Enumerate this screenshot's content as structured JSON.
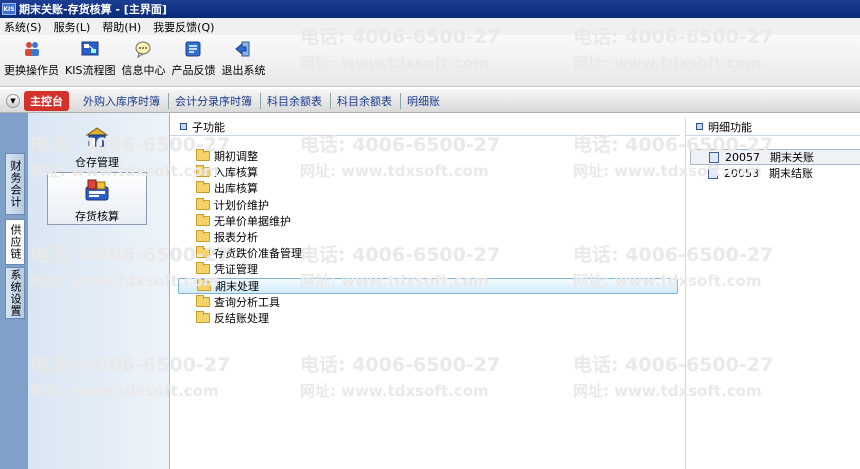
{
  "window": {
    "app_icon_text": "KIS",
    "title": "期末关账-存货核算 - [主界面]"
  },
  "menu": [
    "系统(S)",
    "服务(L)",
    "帮助(H)",
    "我要反馈(Q)"
  ],
  "toolbar": [
    {
      "label": "更换操作员",
      "icon": "user-switch-icon"
    },
    {
      "label": "KIS流程图",
      "icon": "flowchart-icon"
    },
    {
      "label": "信息中心",
      "icon": "message-icon"
    },
    {
      "label": "产品反馈",
      "icon": "feedback-icon"
    },
    {
      "label": "退出系统",
      "icon": "exit-icon"
    }
  ],
  "tabs": {
    "main": "主控台",
    "items": [
      "外购入库序时簿",
      "会计分录序时簿",
      "科目余额表",
      "科目余额表",
      "明细账"
    ]
  },
  "side_tabs": [
    "财务会计",
    "供应链",
    "系统设置"
  ],
  "modules": [
    {
      "label": "仓存管理",
      "icon": "warehouse-icon"
    },
    {
      "label": "存货核算",
      "icon": "inventory-accounting-icon"
    }
  ],
  "subfunctions": {
    "title": "子功能",
    "items": [
      "期初调整",
      "入库核算",
      "出库核算",
      "计划价维护",
      "无单价单据维护",
      "报表分析",
      "存货跌价准备管理",
      "凭证管理",
      "期末处理",
      "查询分析工具",
      "反结账处理"
    ]
  },
  "details": {
    "title": "明细功能",
    "items": [
      {
        "code": "20057",
        "label": "期末关账"
      },
      {
        "code": "20058",
        "label": "期末结账"
      }
    ]
  },
  "watermark": {
    "phone": "电话: 4006-6500-27",
    "url": "网址: www.tdxsoft.com"
  }
}
